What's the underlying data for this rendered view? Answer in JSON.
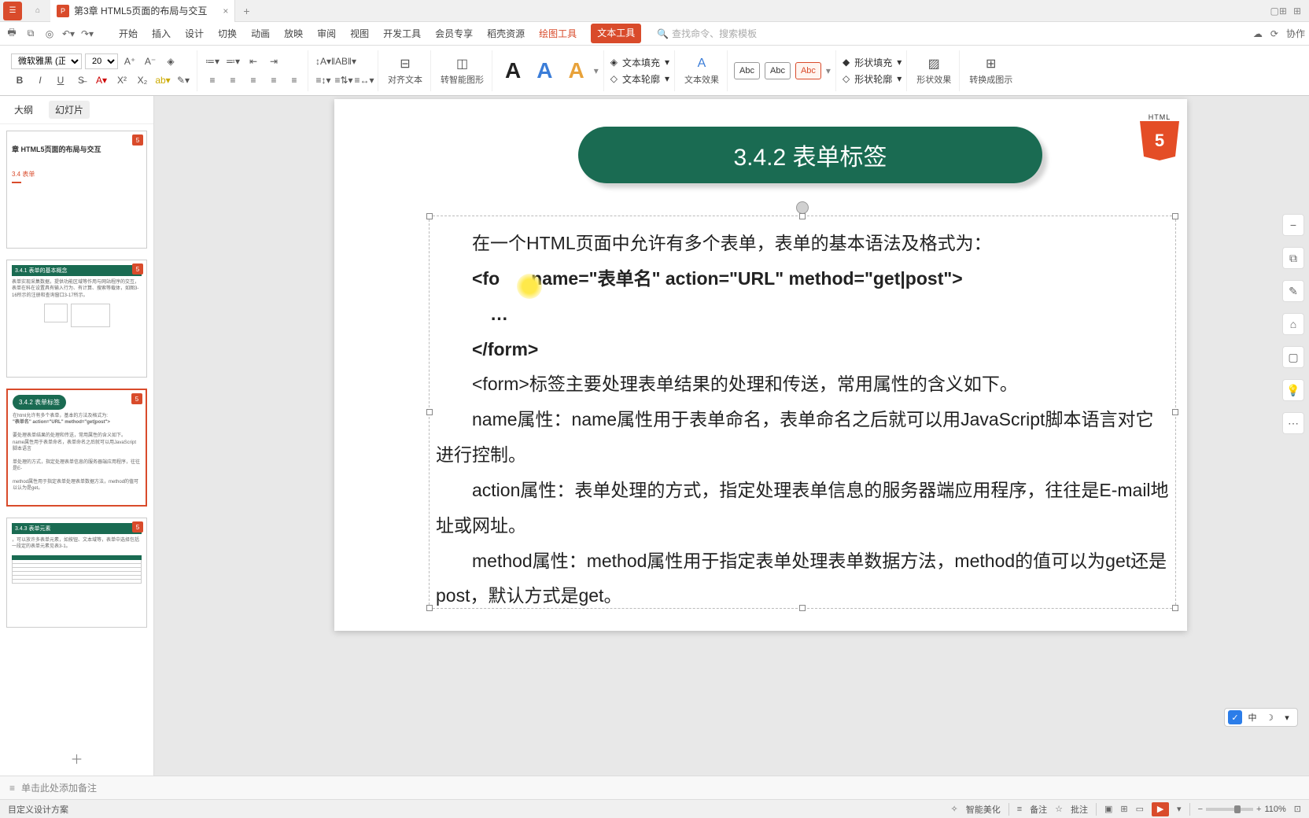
{
  "title_bar": {
    "tab_title": "第3章  HTML5页面的布局与交互"
  },
  "menu": {
    "tabs": [
      "开始",
      "插入",
      "设计",
      "切换",
      "动画",
      "放映",
      "审阅",
      "视图",
      "开发工具",
      "会员专享",
      "稻壳资源"
    ],
    "draw_tool": "绘图工具",
    "text_tool": "文本工具",
    "search_placeholder": "查找命令、搜索模板",
    "collab": "协作"
  },
  "ribbon": {
    "font_name": "微软雅黑 (正文)",
    "font_size": "20",
    "align_label": "对齐文本",
    "smart_shape": "转智能图形",
    "text_fill": "文本填充",
    "text_outline": "文本轮廓",
    "text_effect": "文本效果",
    "abc": "Abc",
    "shape_fill": "形状填充",
    "shape_outline": "形状轮廓",
    "shape_effect": "形状效果",
    "convert_diagram": "转换成图示"
  },
  "side": {
    "tab_outline": "大纲",
    "tab_slides": "幻灯片",
    "t1_title": "章  HTML5页面的布局与交互",
    "t1_sub": "3.4  表单",
    "t2_title": "3.4.1  表单的基本概念",
    "t3_title": "3.4.2  表单标签",
    "t4_title": "3.4.3  表单元素",
    "design_plan": "目定义设计方案"
  },
  "slide": {
    "pill_title": "3.4.2  表单标签",
    "html5_label": "HTML",
    "html5_num": "5",
    "p1": "在一个HTML页面中允许有多个表单，表单的基本语法及格式为：",
    "p2a": "<fo",
    "p2b": "name=\"",
    "p2c": "表单名",
    "p2d": "\" action=\"URL\" method=\"get|post\">",
    "p3": "…",
    "p4": "</form>",
    "p5": "<form>标签主要处理表单结果的处理和传送，常用属性的含义如下。",
    "p6": "name属性：name属性用于表单命名，表单命名之后就可以用JavaScript脚本语言对它进行控制。",
    "p7": "action属性：表单处理的方式，指定处理表单信息的服务器端应用程序，往往是E-mail地址或网址。",
    "p8": "method属性：method属性用于指定表单处理表单数据方法，method的值可以为get还是post，默认方式是get。"
  },
  "notes": {
    "placeholder": "单击此处添加备注"
  },
  "status": {
    "beautify": "智能美化",
    "backup": "备注",
    "comment": "批注",
    "zoom": "110%",
    "ime": "中"
  }
}
